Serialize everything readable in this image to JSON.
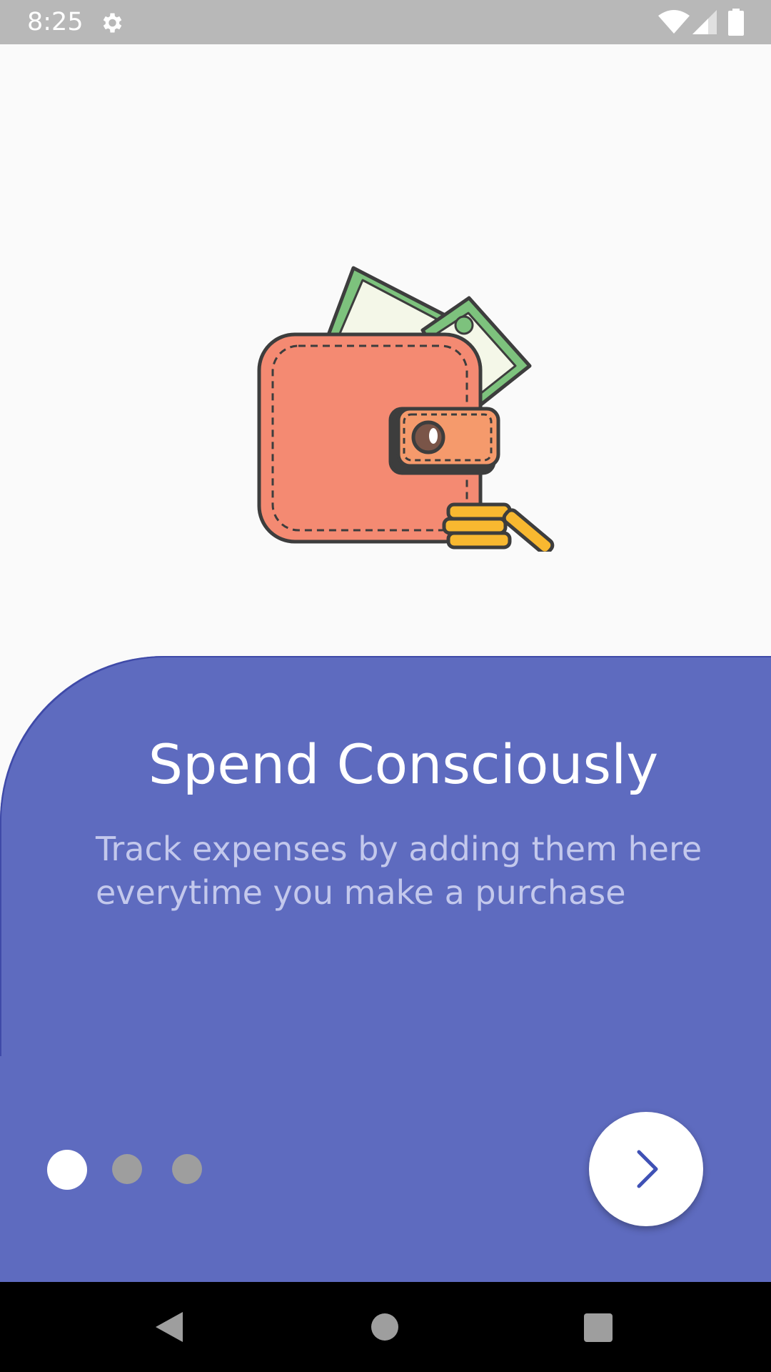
{
  "status_bar": {
    "time": "8:25",
    "icons": [
      "gear-icon",
      "wifi-icon",
      "cell-signal-icon",
      "battery-icon"
    ],
    "background": "#b8b8b8"
  },
  "onboarding": {
    "illustration": "wallet-with-cash-and-coins",
    "title": "Spend Consciously",
    "subtitle": "Track expenses by adding them here everytime you make a purchase",
    "panel_color": "#5e6bbf",
    "page_indicator": {
      "total": 3,
      "current": 1
    },
    "next_icon": "chevron-right-icon"
  },
  "nav_bar": {
    "buttons": [
      "back-icon",
      "home-icon",
      "recents-icon"
    ]
  }
}
